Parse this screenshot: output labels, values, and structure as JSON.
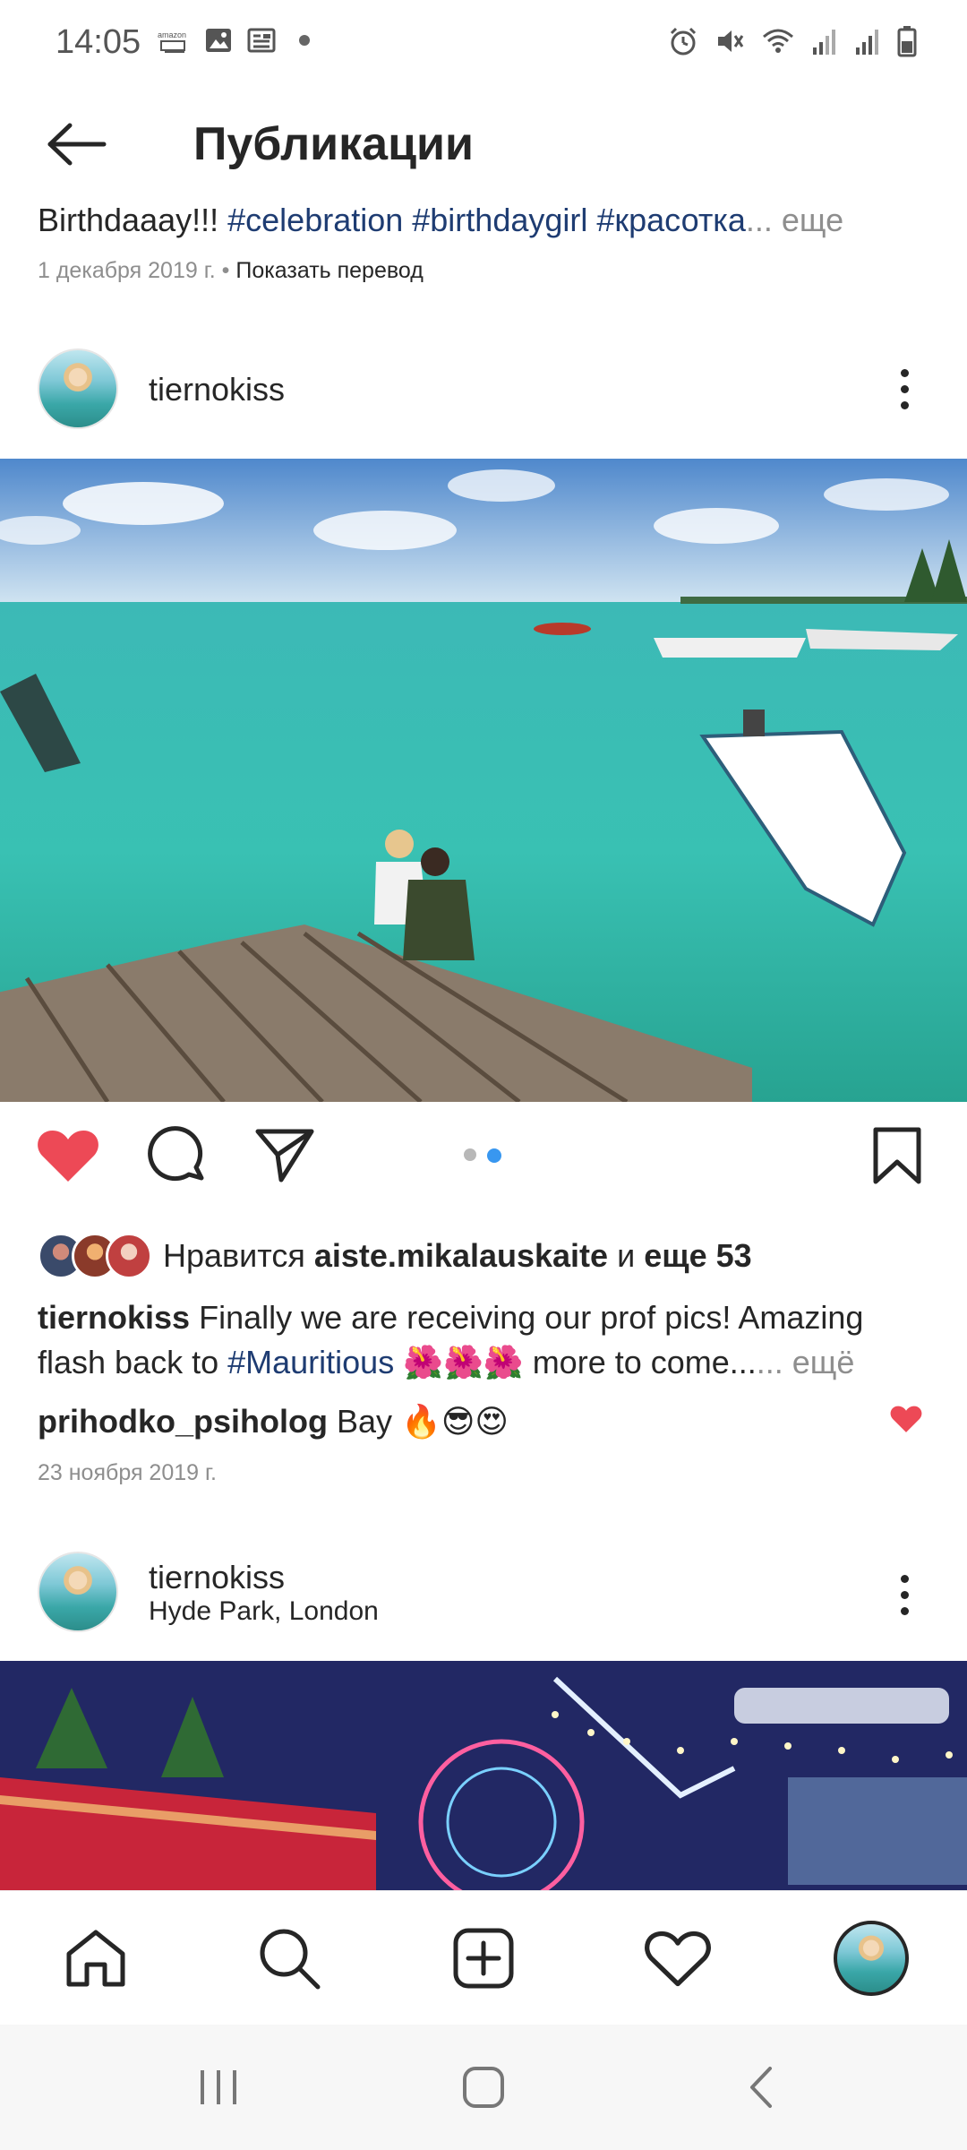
{
  "status_bar": {
    "time": "14:05",
    "left_icons": [
      "amazon-icon",
      "image-icon",
      "news-icon",
      "dot-icon"
    ],
    "right_icons": [
      "alarm-icon",
      "mute-icon",
      "wifi-icon",
      "signal-icon",
      "signal-icon",
      "battery-icon"
    ]
  },
  "header": {
    "title": "Публикации"
  },
  "prev_post": {
    "caption_start": "Birthdaaay!!! ",
    "caption_tags": "#celebration #birthdaygirl #красотка",
    "caption_more": "... еще",
    "date": "1 декабря 2019 г.",
    "separator": " • ",
    "translate": "Показать перевод"
  },
  "post1": {
    "username": "tiernokiss",
    "likes_prefix": "Нравится ",
    "likes_user": "aiste.mikalauskaite",
    "likes_and": " и ",
    "likes_more": "еще 53",
    "caption_user": "tiernokiss",
    "caption_text1": " Finally we are receiving our prof pics! Amazing flash back to ",
    "caption_tag": "#Mauritious",
    "caption_text2": " 🌺🌺🌺 more to come...",
    "caption_more": "... ещё",
    "comment_user": "prihodko_psiholog",
    "comment_text": " Bay 🔥😎😍",
    "date": "23 ноября 2019 г.",
    "carousel": {
      "count": 2,
      "active": 2
    }
  },
  "post2": {
    "username": "tiernokiss",
    "location": "Hyde Park, London"
  },
  "colors": {
    "like_red": "#ed4956",
    "tag_blue": "#1e3c72",
    "carousel_active": "#3897f0"
  }
}
